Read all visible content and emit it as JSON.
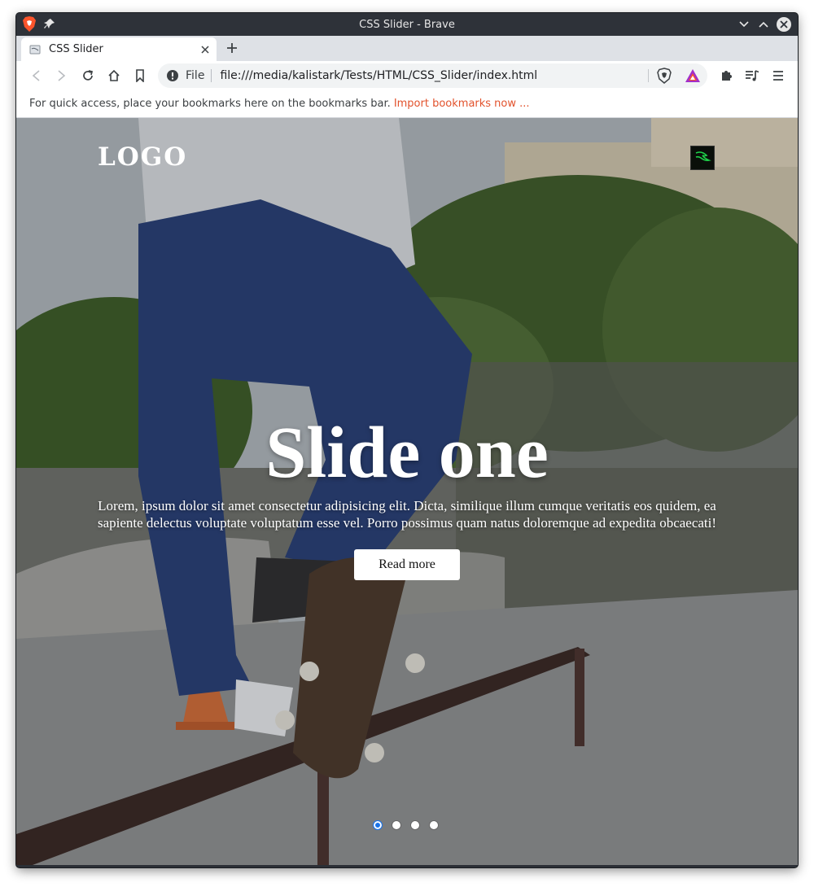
{
  "window": {
    "title": "CSS Slider - Brave"
  },
  "tabs": [
    {
      "label": "CSS Slider",
      "active": true
    }
  ],
  "toolbar": {
    "back_icon": "back-arrow-icon",
    "forward_icon": "forward-arrow-icon",
    "reload_icon": "reload-icon",
    "home_icon": "home-icon",
    "bookmark_icon": "bookmark-icon"
  },
  "omnibox": {
    "scheme_label": "File",
    "url": "file:///media/kalistark/Tests/HTML/CSS_Slider/index.html"
  },
  "bookmarks_bar": {
    "message": "For quick access, place your bookmarks here on the bookmarks bar.",
    "import_link": "Import bookmarks now ..."
  },
  "page": {
    "logo": "LOGO",
    "slide": {
      "title": "Slide one",
      "description": "Lorem, ipsum dolor sit amet consectetur adipisicing elit. Dicta, similique illum cumque veritatis eos quidem, ea sapiente delectus voluptate voluptatum esse vel. Porro possimus quam natus doloremque ad expedita obcaecati!",
      "button_label": "Read more"
    },
    "slider": {
      "total_slides": 4,
      "active_index": 0
    }
  },
  "colors": {
    "titlebar_bg": "#2e3239",
    "tabstrip_bg": "#dee1e6",
    "link_accent": "#e2522c",
    "active_dot": "#1a73e8"
  }
}
